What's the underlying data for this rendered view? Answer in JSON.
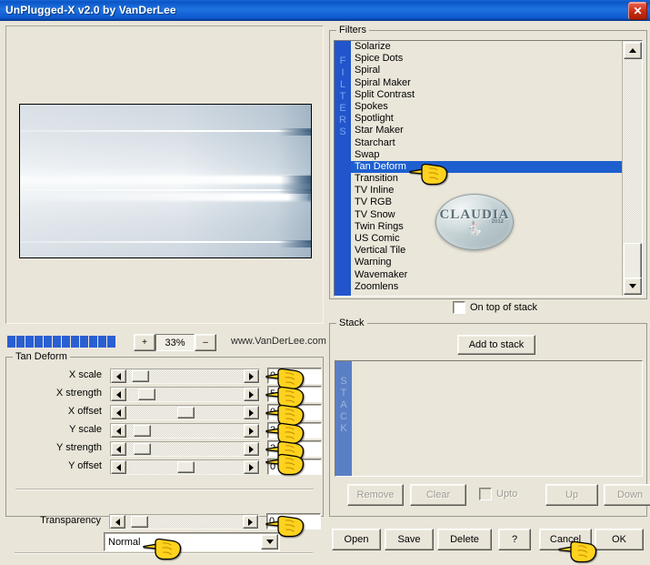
{
  "window": {
    "title": "UnPlugged-X v2.0 by VanDerLee",
    "close_label": "✕"
  },
  "preview": {
    "zoom_value": "33%",
    "zoom_in_label": "+",
    "zoom_out_label": "–",
    "website": "www.VanDerLee.com",
    "progress_segments": 12
  },
  "params": {
    "group_label": "Tan Deform",
    "rows": [
      {
        "label": "X scale",
        "value": "0",
        "thumb_pct": 6
      },
      {
        "label": "X strength",
        "value": "5",
        "thumb_pct": 12
      },
      {
        "label": "X offset",
        "value": "0",
        "thumb_pct": 50
      },
      {
        "label": "Y scale",
        "value": "3",
        "thumb_pct": 8
      },
      {
        "label": "Y strength",
        "value": "2",
        "thumb_pct": 8
      },
      {
        "label": "Y offset",
        "value": "0",
        "thumb_pct": 50
      }
    ],
    "transparency_label": "Transparency",
    "transparency_value": "0",
    "transparency_thumb_pct": 6,
    "blend_mode": "Normal"
  },
  "filters": {
    "group_label": "Filters",
    "side_label": "FILTERS",
    "selected": "Tan Deform",
    "items": [
      "Solarize",
      "Spice Dots",
      "Spiral",
      "Spiral Maker",
      "Split Contrast",
      "Spokes",
      "Spotlight",
      "Star Maker",
      "Starchart",
      "Swap",
      "Tan Deform",
      "Transition",
      "TV Inline",
      "TV RGB",
      "TV Snow",
      "Twin Rings",
      "US Comic",
      "Vertical Tile",
      "Warning",
      "Wavemaker",
      "Zoomlens"
    ],
    "on_top_of_stack_label": "On top of stack",
    "on_top_of_stack_checked": false,
    "watermark": {
      "name": "CLAUDIA",
      "sub": "2012"
    }
  },
  "stack": {
    "group_label": "Stack",
    "side_label": "STACK",
    "add_label": "Add to stack",
    "items": [],
    "actions": [
      {
        "label": "Remove",
        "enabled": false
      },
      {
        "label": "Clear",
        "enabled": false
      },
      {
        "label": "Up",
        "enabled": false
      },
      {
        "label": "Down",
        "enabled": false
      }
    ],
    "upto_label": "Upto",
    "upto_checked": false
  },
  "bottom_buttons": [
    {
      "label": "Open"
    },
    {
      "label": "Save"
    },
    {
      "label": "Delete"
    },
    {
      "label": "?"
    },
    {
      "label": "Cancel"
    },
    {
      "label": "OK"
    }
  ],
  "colors": {
    "title_blue": "#0b55c8",
    "accent_blue": "#2255cc",
    "selection_blue": "#1e5fd0",
    "stack_blue": "#5b7fc4",
    "face": "#e9e5d9",
    "close_red": "#c92b12"
  }
}
